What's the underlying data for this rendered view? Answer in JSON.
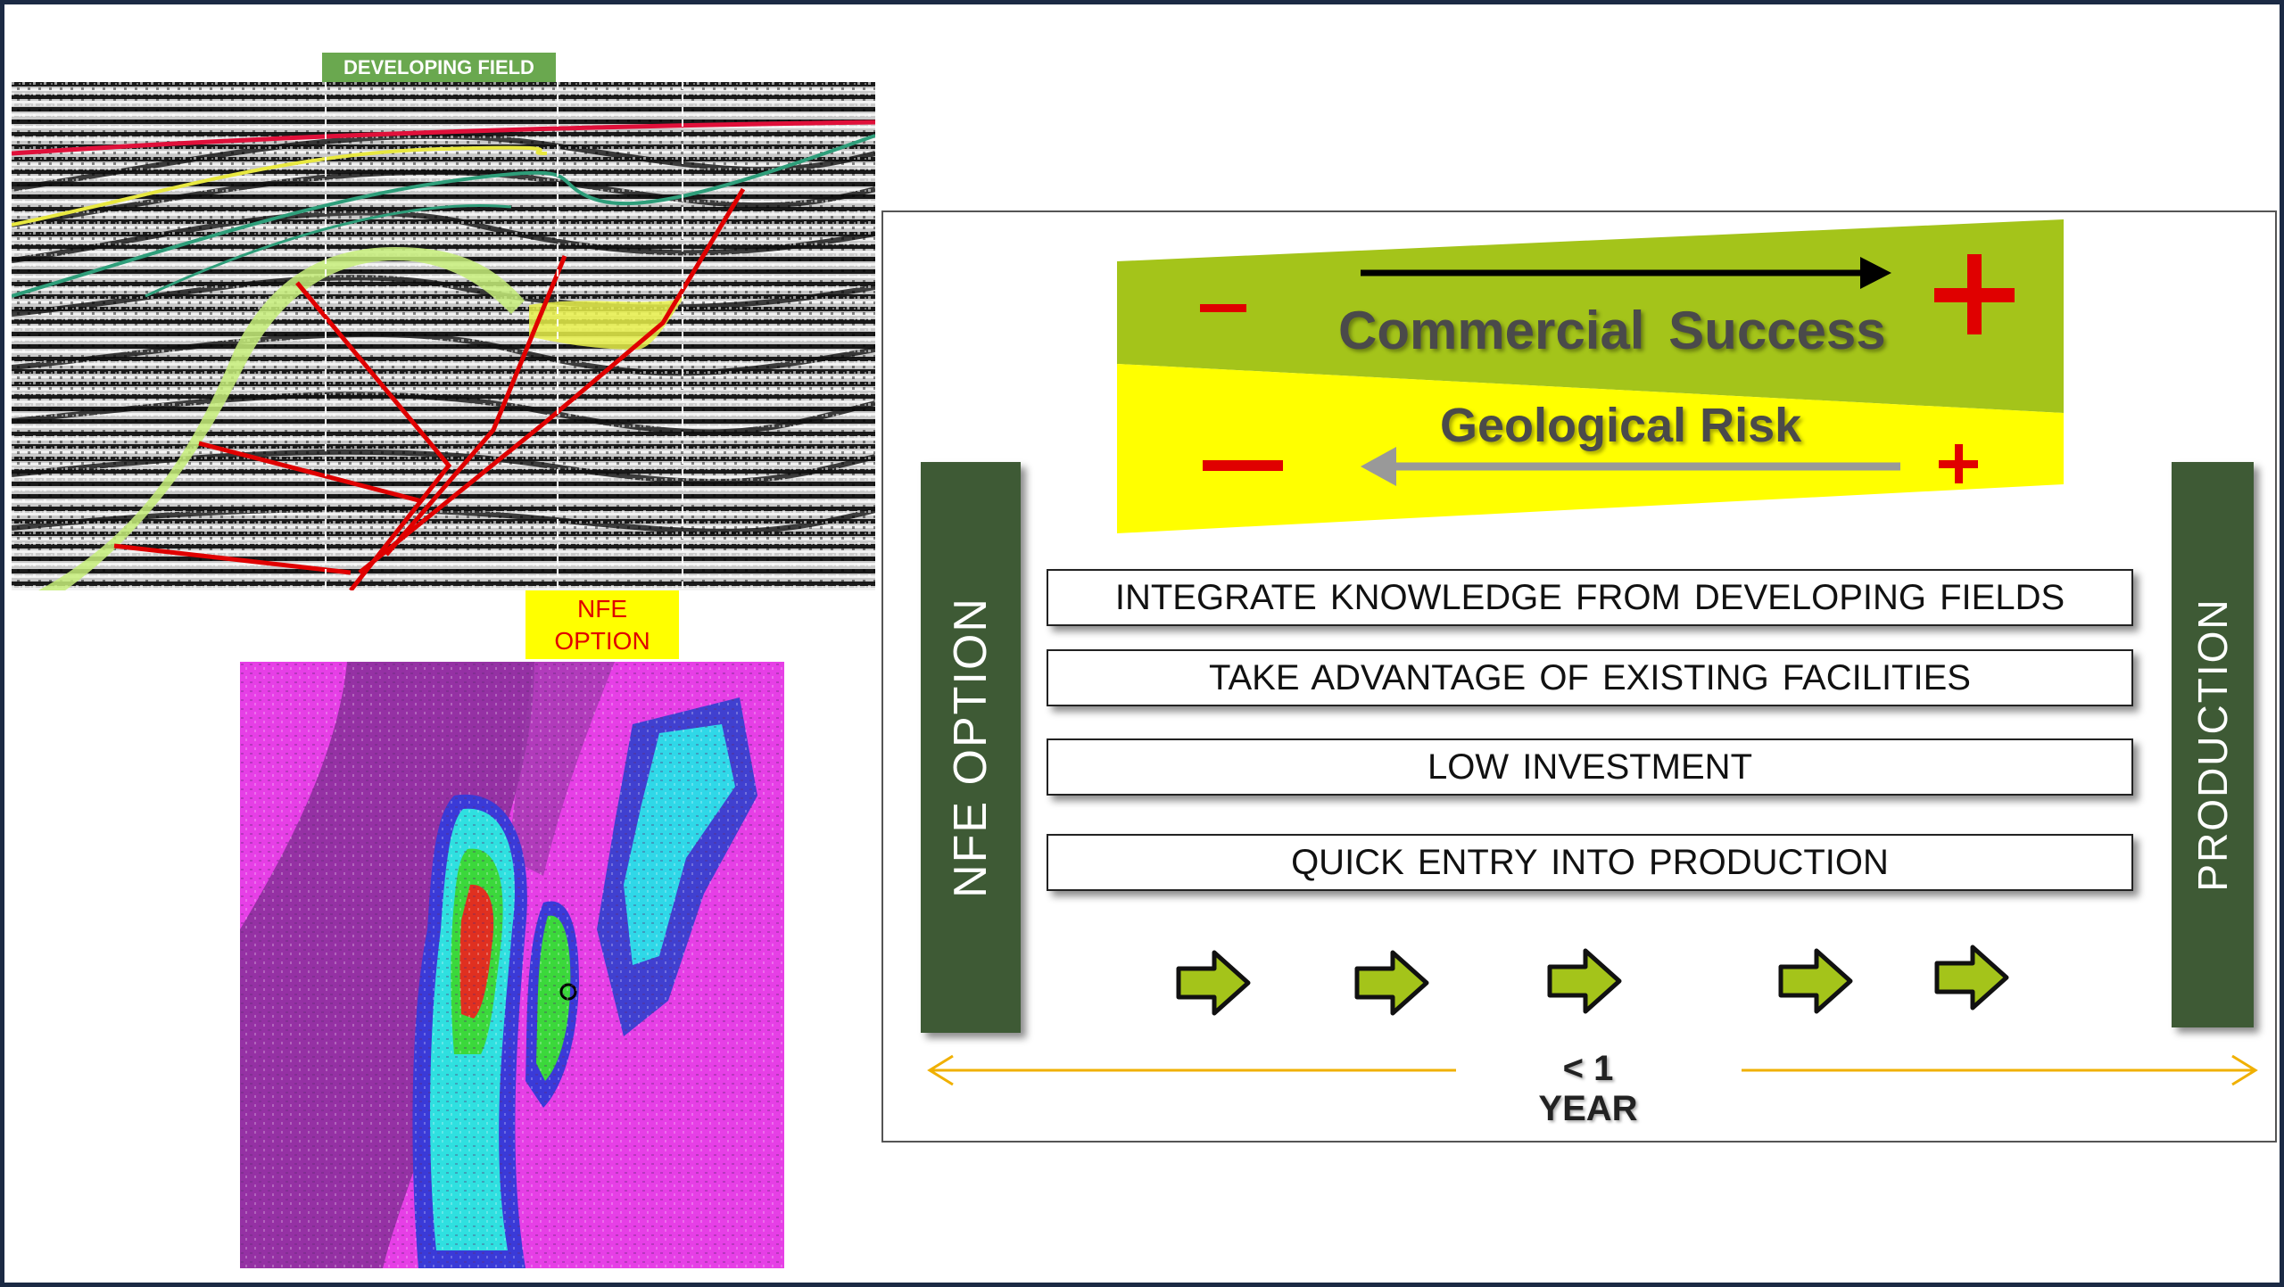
{
  "labels": {
    "developing_field": "DEVELOPING FIELD",
    "nfe_option_line1": "NFE",
    "nfe_option_line2": "OPTION"
  },
  "panel": {
    "commercial_success": "Commercial  Success",
    "geological_risk": "Geological Risk",
    "minus": "–",
    "plus": "+",
    "left_column": "NFE OPTION",
    "right_column": "PRODUCTION",
    "items": [
      "INTEGRATE KNOWLEDGE FROM DEVELOPING FIELDS",
      "TAKE ADVANTAGE  OF EXISTING  FACILITIES",
      "LOW INVESTMENT",
      "QUICK  ENTRY  INTO  PRODUCTION"
    ],
    "timeline": "< 1 YEAR"
  },
  "colors": {
    "frame": "#1b2a44",
    "green_label": "#6aa84f",
    "wedge_green": "#a4c41a",
    "wedge_yellow": "#ffff00",
    "column": "#3e5a35",
    "arrow": "#a4c41a",
    "timeline": "#f0b000",
    "red": "#e00000"
  }
}
